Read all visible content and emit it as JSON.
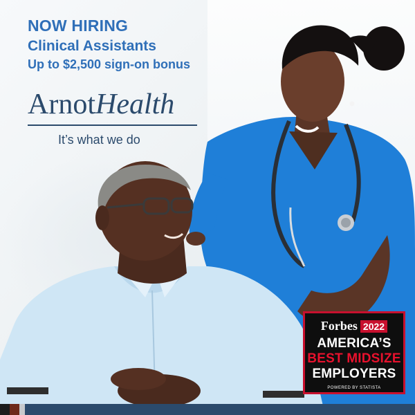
{
  "headline": {
    "line1": "NOW HIRING",
    "line2": "Clinical Assistants",
    "line3": "Up to $2,500 sign-on bonus"
  },
  "logo": {
    "arnot": "Arnot",
    "health": "Health",
    "tagline": "It’s what we do"
  },
  "badge": {
    "forbes": "Forbes",
    "year": "2022",
    "line1": "AMERICA’S",
    "line2": "BEST MIDSIZE",
    "line3": "EMPLOYERS",
    "powered": "POWERED BY STATISTA"
  },
  "colors": {
    "brand_blue": "#2f6fb8",
    "navy": "#2b4a6c",
    "scrubs": "#1f7fd8",
    "badge_red": "#c8102e"
  }
}
